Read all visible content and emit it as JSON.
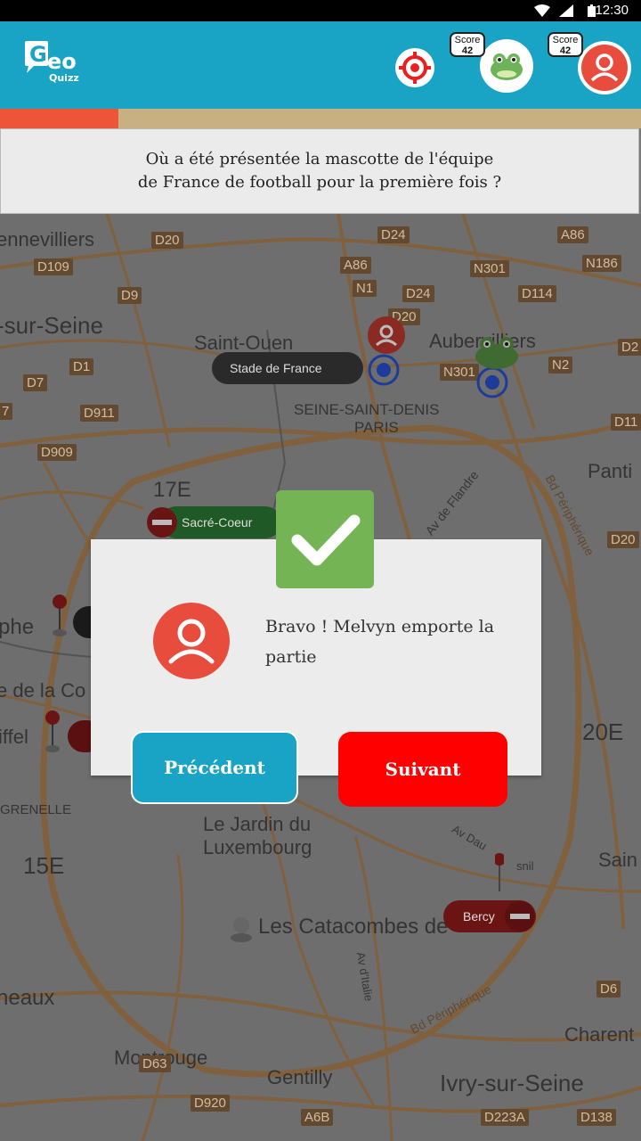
{
  "status_bar": {
    "time": "12:30"
  },
  "app": {
    "logo_text_top": "Geo",
    "logo_text_bottom": "Quizz"
  },
  "players": [
    {
      "score_label": "Score",
      "score_value": "42",
      "avatar": "frog-icon"
    },
    {
      "score_label": "Score",
      "score_value": "42",
      "avatar": "user-icon"
    }
  ],
  "progress": {
    "fraction": 0.185,
    "fill_color": "#ee5538",
    "track_color": "#c8b083"
  },
  "question": {
    "line1": "Où a été présentée la mascotte de l'équipe",
    "line2": "de France de football pour la première fois ?"
  },
  "map": {
    "places": [
      "ennevilliers",
      "-sur-Seine",
      "Saint-Ouen",
      "Aubervilliers",
      "SEINE-SAINT-DENIS",
      "PARIS",
      "17E",
      "Panti",
      "phe",
      "e de la Co",
      "iffel",
      "GRENELLE",
      "Le Jardin du",
      "Luxembourg",
      "15E",
      "20E",
      "Sain",
      "neaux",
      "Les Catacombes de",
      "Montrouge",
      "Gentilly",
      "Ivry-sur-Seine",
      "Charent"
    ],
    "roads": [
      "D20",
      "D24",
      "A86",
      "N186",
      "D109",
      "A86",
      "N301",
      "D9",
      "N1",
      "D24",
      "D114",
      "D20",
      "D2",
      "D1",
      "N301",
      "N2",
      "D7",
      "D911",
      "D11",
      "7",
      "D909",
      "D20",
      "D6",
      "D63",
      "D920",
      "A6B",
      "D223A",
      "D138"
    ],
    "street_labels": [
      "Bd Périphérique",
      "Av de Flandre",
      "Av Dau",
      "snil",
      "Av d'Italie",
      "Bd Périphérique"
    ],
    "markers": [
      {
        "label": "Stade de France",
        "kind": "answer"
      },
      {
        "label": "Sacré-Coeur",
        "kind": "wrong"
      },
      {
        "label": "Bercy",
        "kind": "wrong"
      }
    ]
  },
  "dialog": {
    "message": "Bravo ! Melvyn emporte la partie",
    "prev_label": "Précédent",
    "next_label": "Suivant"
  },
  "colors": {
    "appbar": "#19a3c4",
    "success": "#75b455",
    "danger": "#ff0000",
    "avatar_red": "#e74c3c"
  }
}
